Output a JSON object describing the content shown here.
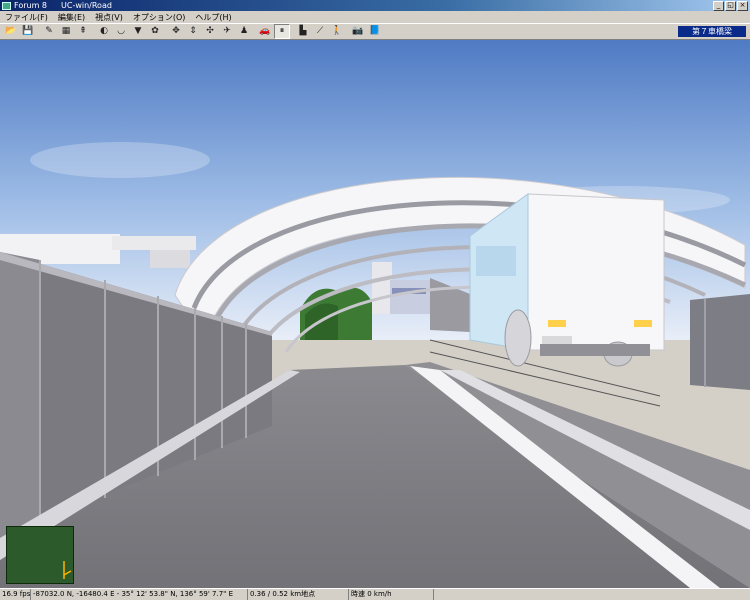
{
  "window": {
    "app_name": "Forum 8",
    "title": "UC-win/Road",
    "controls": [
      "_",
      "◱",
      "×"
    ]
  },
  "menu": [
    "ファイル(F)",
    "編集(E)",
    "視点(V)",
    "オプション(O)",
    "ヘルプ(H)"
  ],
  "toolbar": {
    "buttons": [
      {
        "icon": "open-folder-icon",
        "glyph": "📂"
      },
      {
        "icon": "save-icon",
        "glyph": "💾"
      },
      {
        "icon": "edit-pencil-icon",
        "glyph": "✎"
      },
      {
        "icon": "grid-icon",
        "glyph": "▦"
      },
      {
        "icon": "tree-icon",
        "glyph": "⇞"
      },
      {
        "icon": "flag-icon",
        "glyph": "◐"
      },
      {
        "icon": "bowl-icon",
        "glyph": "◡"
      },
      {
        "icon": "triangle-icon",
        "glyph": "▼"
      },
      {
        "icon": "settings-icon",
        "glyph": "✿"
      },
      {
        "icon": "move-icon",
        "glyph": "✥"
      },
      {
        "icon": "altitude-icon",
        "glyph": "⇕"
      },
      {
        "icon": "rotate-icon",
        "glyph": "✣"
      },
      {
        "icon": "airplane-icon",
        "glyph": "✈"
      },
      {
        "icon": "person-icon",
        "glyph": "♟"
      },
      {
        "icon": "car-icon",
        "glyph": "🚗"
      },
      {
        "icon": "pause-icon",
        "glyph": "⏸"
      },
      {
        "icon": "chart-icon",
        "glyph": "▙"
      },
      {
        "icon": "road-icon",
        "glyph": "⟋"
      },
      {
        "icon": "walk-icon",
        "glyph": "🚶"
      },
      {
        "icon": "camera-icon",
        "glyph": "📷"
      },
      {
        "icon": "book-icon",
        "glyph": "📘"
      }
    ],
    "scene_selector": "第７車橋梁"
  },
  "status": {
    "fps": "16.9 fps",
    "coordinates": "-87032.0 N, -16480.4 E  -  35° 12' 53.8\" N, 136° 59' 7.7\" E",
    "distance": "0.36 / 0.52 km地点",
    "speed": "時速 0 km/h"
  },
  "colors": {
    "sky_top": "#5a84c8",
    "sky_bottom": "#dfe8f5",
    "road": "#7d7d82",
    "arch": "#f6f6f8",
    "barrier": "#7a7a80",
    "truck_cab": "#cce6f5",
    "grass": "#3d7a34"
  }
}
